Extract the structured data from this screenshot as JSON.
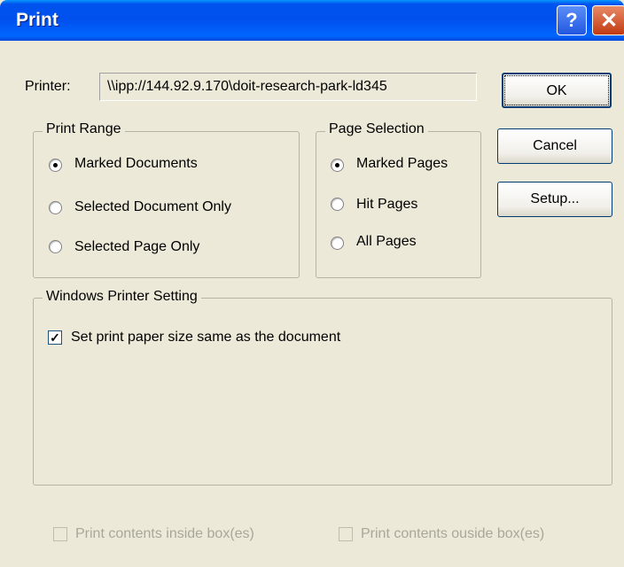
{
  "window": {
    "title": "Print",
    "help_glyph": "?",
    "close_glyph": "✕"
  },
  "printer": {
    "label": "Printer:",
    "value": "\\\\ipp://144.92.9.170\\doit-research-park-ld345"
  },
  "buttons": {
    "ok": "OK",
    "cancel": "Cancel",
    "setup": "Setup..."
  },
  "print_range": {
    "title": "Print Range",
    "options": [
      {
        "label": "Marked Documents",
        "selected": true
      },
      {
        "label": "Selected Document Only",
        "selected": false
      },
      {
        "label": "Selected Page Only",
        "selected": false
      }
    ]
  },
  "page_selection": {
    "title": "Page Selection",
    "options": [
      {
        "label": "Marked Pages",
        "selected": true
      },
      {
        "label": "Hit Pages",
        "selected": false
      },
      {
        "label": "All Pages",
        "selected": false
      }
    ]
  },
  "windows_printer_setting": {
    "title": "Windows Printer Setting",
    "paper_size_label": "Set print paper size same as the document",
    "paper_size_checked": true
  },
  "box_options": {
    "inside_label": "Print contents inside box(es)",
    "outside_label": "Print contents ouside box(es)"
  }
}
